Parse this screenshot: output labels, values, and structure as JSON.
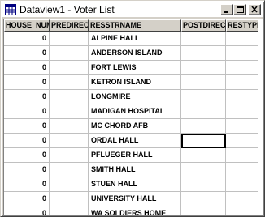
{
  "window": {
    "title": "Dataview1 - Voter List",
    "buttons": {
      "minimize": "minimize",
      "maximize": "maximize",
      "close": "close"
    }
  },
  "table": {
    "columns": [
      "HOUSE_NUM",
      "PREDIRECT",
      "RESSTRNAME",
      "POSTDIRECT",
      "RESTYPE"
    ],
    "rows": [
      [
        "0",
        "",
        "ALPINE HALL",
        "",
        ""
      ],
      [
        "0",
        "",
        "ANDERSON ISLAND",
        "",
        ""
      ],
      [
        "0",
        "",
        "FORT LEWIS",
        "",
        ""
      ],
      [
        "0",
        "",
        "KETRON ISLAND",
        "",
        ""
      ],
      [
        "0",
        "",
        "LONGMIRE",
        "",
        ""
      ],
      [
        "0",
        "",
        "MADIGAN HOSPITAL",
        "",
        ""
      ],
      [
        "0",
        "",
        "MC CHORD AFB",
        "",
        ""
      ],
      [
        "0",
        "",
        "ORDAL HALL",
        "",
        ""
      ],
      [
        "0",
        "",
        "PFLUEGER HALL",
        "",
        ""
      ],
      [
        "0",
        "",
        "SMITH HALL",
        "",
        ""
      ],
      [
        "0",
        "",
        "STUEN HALL",
        "",
        ""
      ],
      [
        "0",
        "",
        "UNIVERSITY HALL",
        "",
        ""
      ],
      [
        "0",
        "",
        "WA SOLDIERS HOME",
        "",
        ""
      ]
    ],
    "focused_cell": {
      "row": 7,
      "column": "POSTDIRECT"
    }
  }
}
